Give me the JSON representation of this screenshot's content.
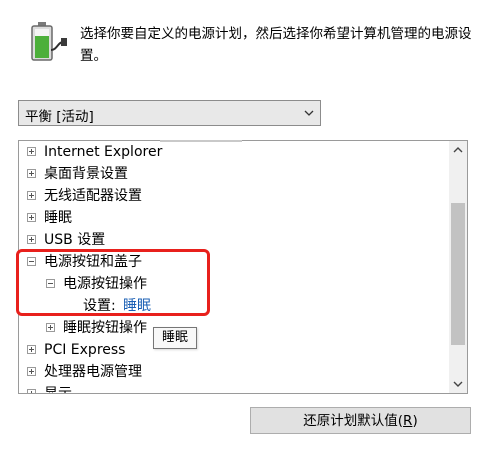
{
  "intro_text": "选择你要自定义的电源计划，然后选择你希望计算机管理的电源设置。",
  "plan_select": {
    "value": "平衡 [活动]"
  },
  "tree": {
    "items": [
      {
        "label": "Internet Explorer",
        "state": "collapsed"
      },
      {
        "label": "桌面背景设置",
        "state": "collapsed"
      },
      {
        "label": "无线适配器设置",
        "state": "collapsed"
      },
      {
        "label": "睡眠",
        "state": "collapsed"
      },
      {
        "label": "USB 设置",
        "state": "collapsed"
      },
      {
        "label": "电源按钮和盖子",
        "state": "expanded"
      },
      {
        "label": "电源按钮操作",
        "state": "expanded"
      },
      {
        "label": "设置:",
        "value": "睡眠"
      },
      {
        "label": "睡眠按钮操作",
        "state": "collapsed"
      },
      {
        "label": "PCI Express",
        "state": "collapsed"
      },
      {
        "label": "处理器电源管理",
        "state": "collapsed"
      },
      {
        "label": "显示",
        "state": "collapsed"
      }
    ]
  },
  "tooltip": "睡眠",
  "restore_button": {
    "label_main": "还原计划默认值(",
    "label_key": "R",
    "label_end": ")"
  },
  "colors": {
    "highlight": "#e8201c",
    "link_value": "#1a5fb4"
  }
}
